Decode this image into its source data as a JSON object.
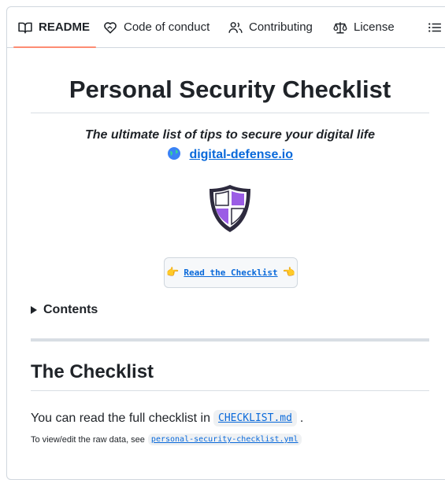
{
  "tabs": [
    {
      "label": "README",
      "icon": "book-icon",
      "active": true
    },
    {
      "label": "Code of conduct",
      "icon": "heart-hand-icon"
    },
    {
      "label": "Contributing",
      "icon": "people-icon"
    },
    {
      "label": "License",
      "icon": "scale-icon"
    }
  ],
  "outline_icon": "list-icon",
  "readme": {
    "title": "Personal Security Checklist",
    "tagline": "The ultimate list of tips to secure your digital life",
    "site_emoji": "🌐",
    "site_link": "digital-defense.io",
    "logo": "shield-logo",
    "cta": {
      "left_emoji": "👉",
      "label": "Read the Checklist",
      "right_emoji": "👈"
    },
    "contents_label": "Contents",
    "section_title": "The Checklist",
    "para_prefix": "You can read the full checklist in",
    "para_code": "CHECKLIST.md",
    "para_suffix": ".",
    "small_prefix": "To view/edit the raw data, see",
    "small_code": "personal-security-checklist.yml"
  },
  "colors": {
    "accent": "#fd8c73",
    "link": "#0969da",
    "shield_purple": "#9b5de5",
    "shield_dark": "#2d2a3e"
  }
}
